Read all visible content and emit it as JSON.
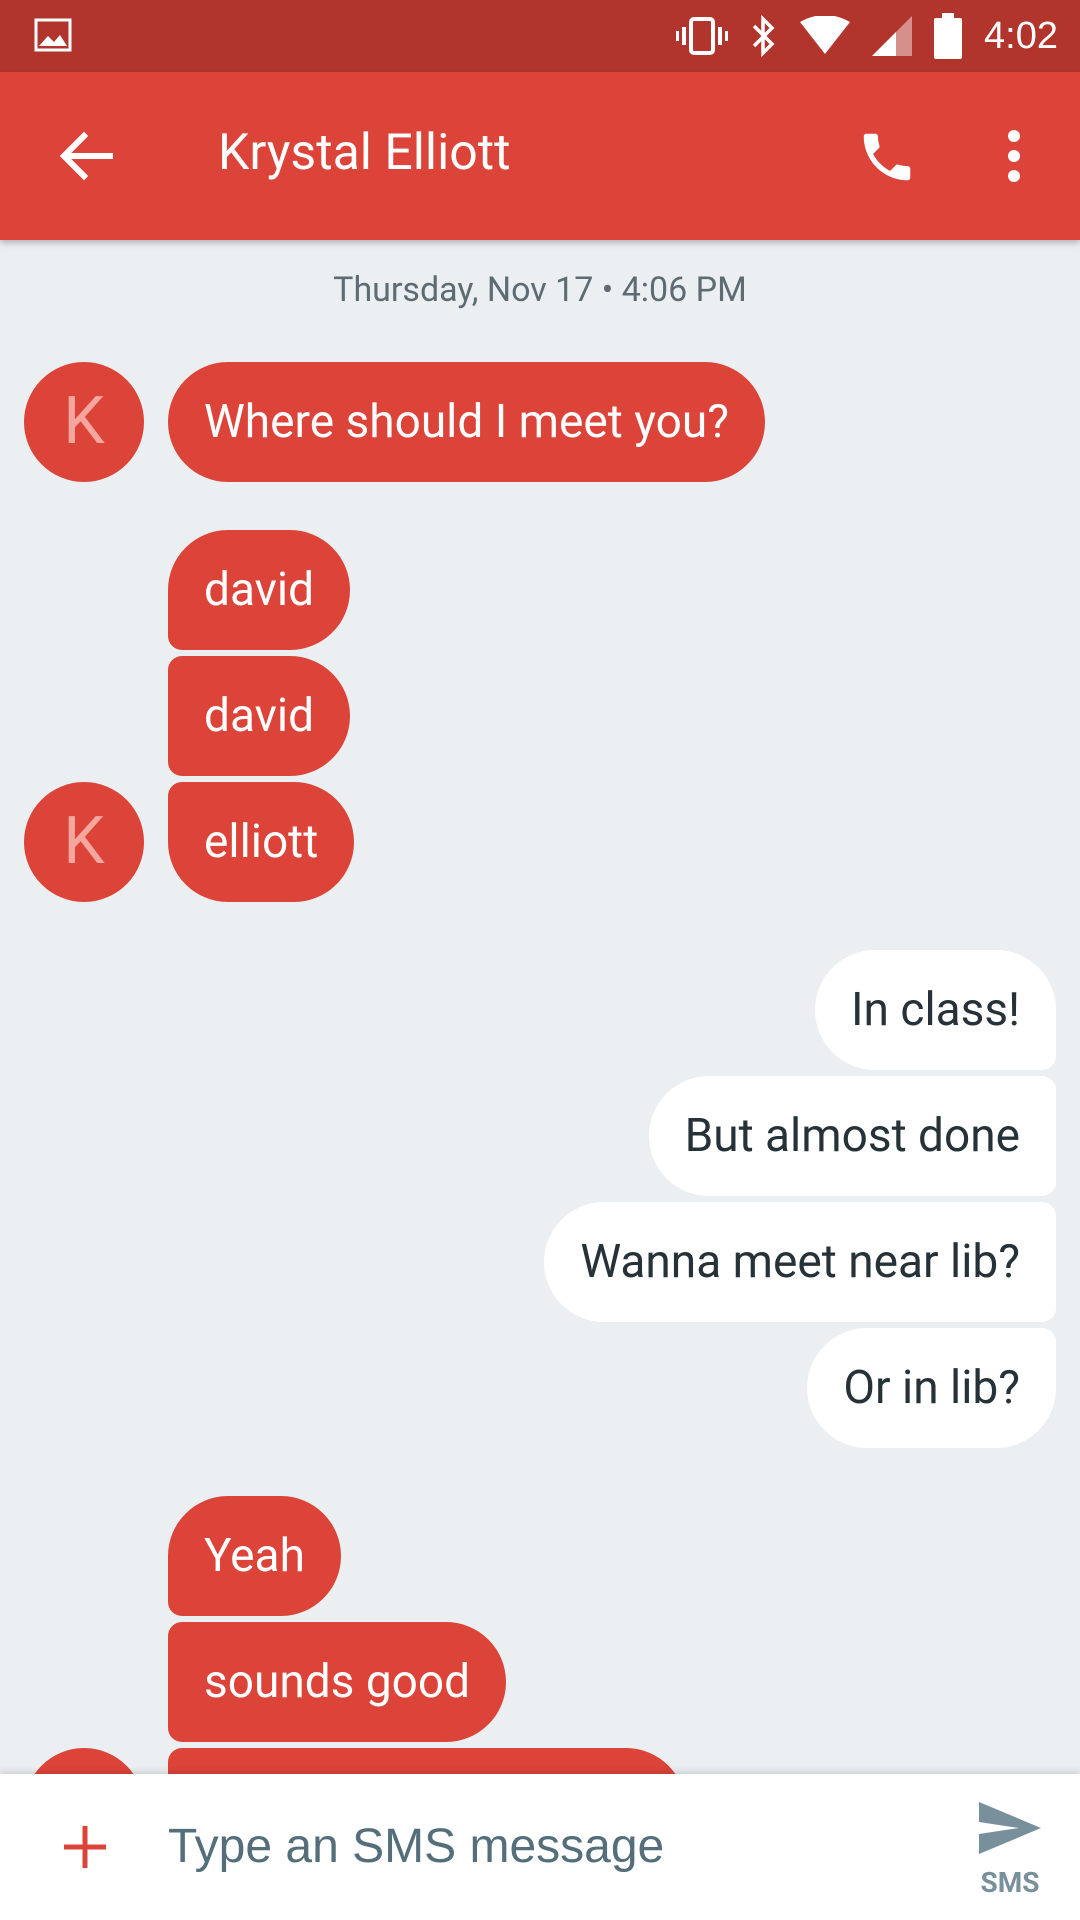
{
  "status_bar": {
    "time": "4:02"
  },
  "app_bar": {
    "title": "Krystal Elliott"
  },
  "conversation": {
    "date_header": "Thursday, Nov 17 • 4:06 PM",
    "avatar_letter": "K",
    "messages": [
      {
        "text": "Where should I meet you?",
        "direction": "incoming"
      },
      {
        "text": "david",
        "direction": "incoming"
      },
      {
        "text": "david",
        "direction": "incoming"
      },
      {
        "text": "elliott",
        "direction": "incoming"
      },
      {
        "text": "In class!",
        "direction": "outgoing"
      },
      {
        "text": "But almost done",
        "direction": "outgoing"
      },
      {
        "text": "Wanna meet near lib?",
        "direction": "outgoing"
      },
      {
        "text": "Or in lib?",
        "direction": "outgoing"
      },
      {
        "text": "Yeah",
        "direction": "incoming"
      },
      {
        "text": "sounds good",
        "direction": "incoming"
      }
    ]
  },
  "compose": {
    "placeholder": "Type an SMS message",
    "send_label": "SMS"
  },
  "colors": {
    "primary": "#dc4439",
    "status_bar": "#b2352d",
    "background": "#eceff1",
    "outgoing_bubble": "#ffffff"
  }
}
